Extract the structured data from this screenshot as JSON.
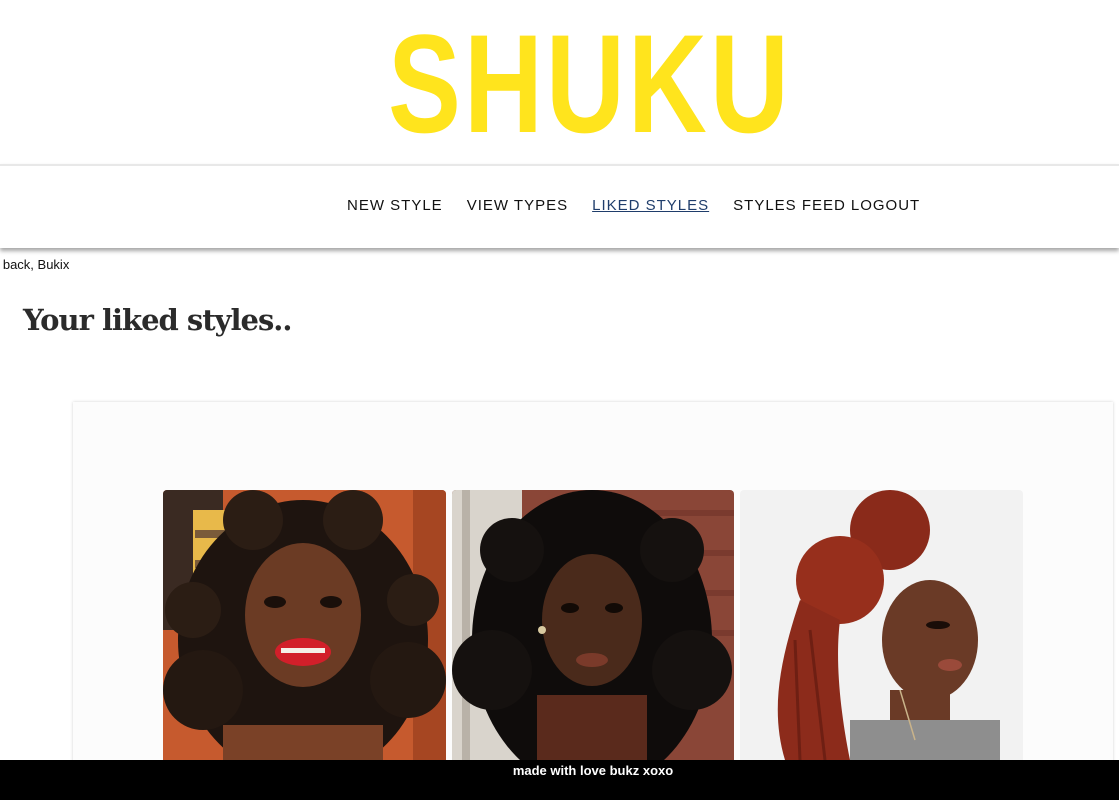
{
  "header": {
    "logo_text": "SHUKU",
    "logo_color": "#FFE41D"
  },
  "nav": {
    "items": [
      {
        "label": "NEW STYLE",
        "active": false
      },
      {
        "label": "VIEW TYPES",
        "active": false
      },
      {
        "label": "LIKED STYLES",
        "active": true
      },
      {
        "label": "STYLES FEED",
        "active": false
      },
      {
        "label": "LOGOUT",
        "active": false
      }
    ],
    "active_color": "#1f3d6b"
  },
  "welcome": {
    "text": "e back, Bukix"
  },
  "main": {
    "heading": "Your liked styles..",
    "liked_styles": [
      {
        "image": "curly-hair-portrait-photo"
      },
      {
        "image": "long-curly-hair-portrait-photo"
      },
      {
        "image": "red-braids-bun-portrait-photo"
      }
    ]
  },
  "footer": {
    "text": "made with love bukz xoxo"
  }
}
